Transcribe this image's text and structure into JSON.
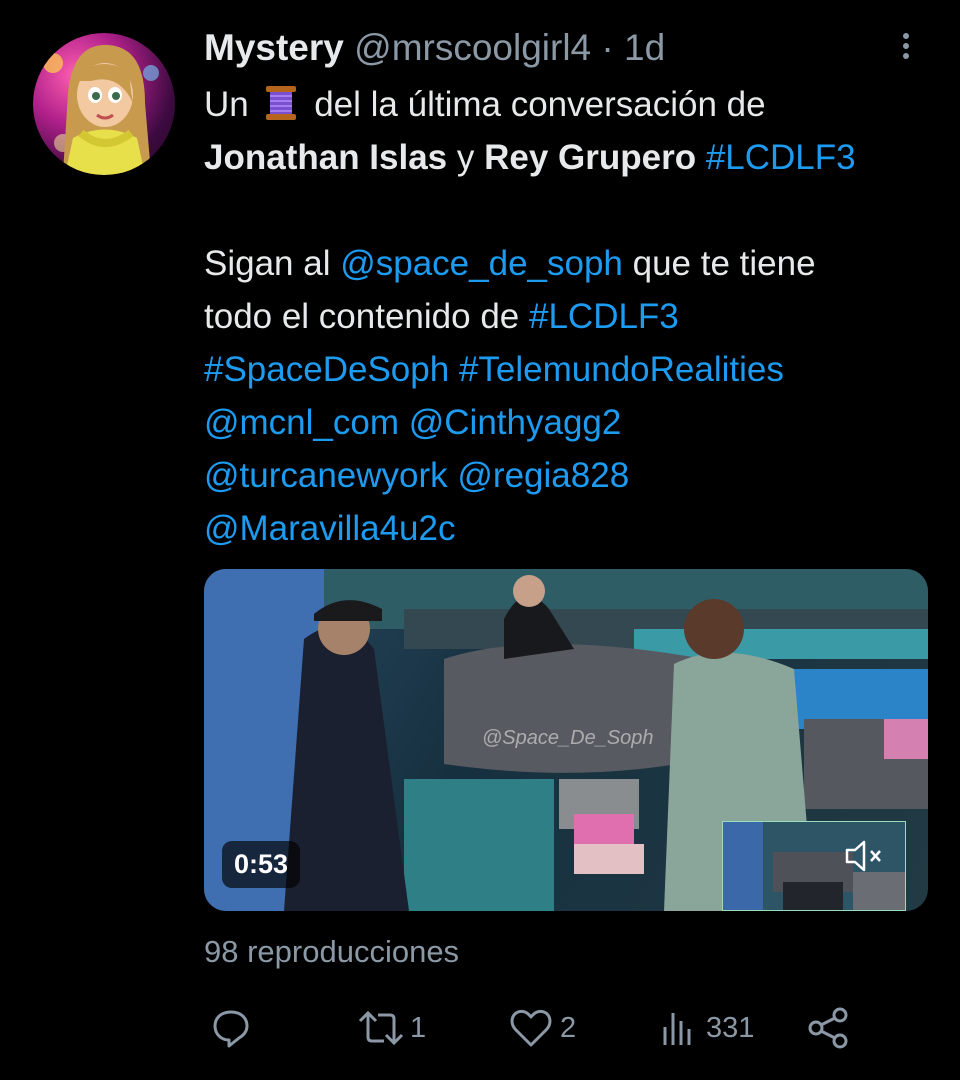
{
  "tweet": {
    "author_name": "Mystery",
    "author_handle": "@mrscoolgirl4",
    "separator": "·",
    "time": "1d",
    "text": {
      "l1_a": "Un",
      "l1_b": "del la última conversación de",
      "l2_name1": "Jonathan Islas",
      "l2_and": " y ",
      "l2_name2": "Rey Grupero",
      "l2_tag": "#LCDLF3",
      "l3_a": "Sigan al ",
      "l3_mention": "@space_de_soph",
      "l3_b": " que te tiene",
      "l4_a": "todo el contenido de ",
      "l4_tag": "#LCDLF3",
      "l5_tag1": "#SpaceDeSoph",
      "l5_tag2": "#TelemundoRealities",
      "l6_m1": "@mcnl_com",
      "l6_m2": "@Cinthyagg2",
      "l7_m1": "@turcanewyork",
      "l7_m2": "@regia828",
      "l8_m1": "@Maravilla4u2c"
    },
    "video": {
      "watermark": "@Space_De_Soph",
      "duration": "0:53"
    },
    "views": "98 reproducciones",
    "metrics": {
      "retweets": "1",
      "likes": "2",
      "analytics": "331"
    }
  },
  "icons": {
    "more": "more-vertical-icon",
    "reply": "reply-icon",
    "retweet": "retweet-icon",
    "like": "heart-icon",
    "analytics": "analytics-icon",
    "share": "share-icon",
    "mute": "speaker-muted-icon",
    "emoji": "thread-spool-emoji"
  },
  "colors": {
    "background": "#000000",
    "text": "#e7e9ea",
    "secondary": "#8b98a5",
    "link": "#1d9bf0"
  }
}
